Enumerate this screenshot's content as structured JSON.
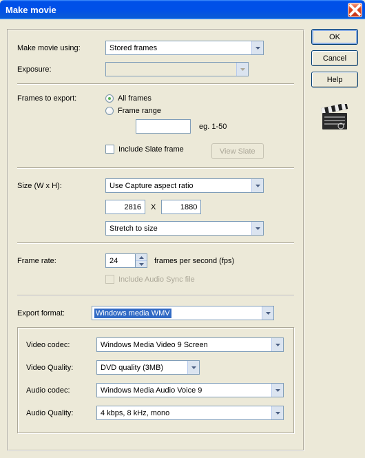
{
  "window": {
    "title": "Make movie"
  },
  "buttons": {
    "ok": "OK",
    "cancel": "Cancel",
    "help": "Help",
    "viewSlate": "View Slate"
  },
  "labels": {
    "makeMovieUsing": "Make movie using:",
    "exposure": "Exposure:",
    "framesToExport": "Frames to export:",
    "allFrames": "All frames",
    "frameRange": "Frame range",
    "frameRangeHint": "eg. 1-50",
    "includeSlate": "Include Slate frame",
    "size": "Size (W x H):",
    "by": "X",
    "frameRate": "Frame rate:",
    "fps": "frames per second (fps)",
    "includeAudioSync": "Include Audio Sync file",
    "exportFormat": "Export format:",
    "videoCodec": "Video codec:",
    "videoQuality": "Video Quality:",
    "audioCodec": "Audio codec:",
    "audioQuality": "Audio Quality:"
  },
  "values": {
    "makeMovieUsing": "Stored frames",
    "exposure": "",
    "frameRangeInput": "",
    "sizeMode": "Use Capture aspect ratio",
    "width": "2816",
    "height": "1880",
    "stretch": "Stretch to size",
    "frameRate": "24",
    "exportFormat": "Windows media WMV",
    "videoCodec": "Windows Media Video 9 Screen",
    "videoQuality": "DVD quality  (3MB)",
    "audioCodec": "Windows Media Audio Voice 9",
    "audioQuality": "4 kbps, 8 kHz, mono"
  },
  "state": {
    "framesExport": "all",
    "includeSlate": false,
    "includeAudioSync": false
  }
}
